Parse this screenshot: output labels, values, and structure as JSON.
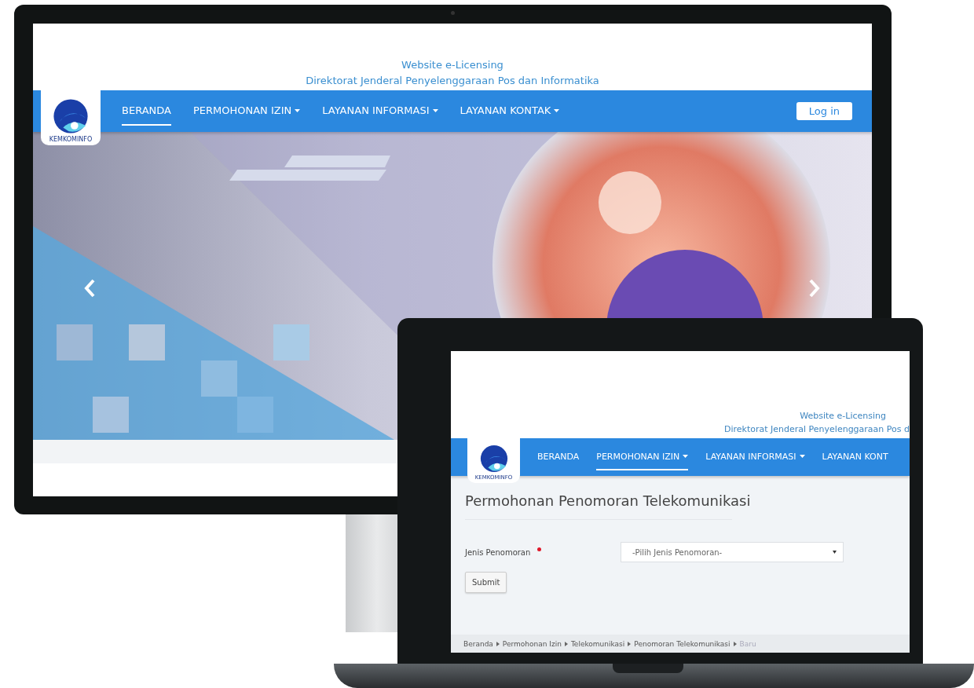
{
  "monitor": {
    "header": {
      "title": "Website e-Licensing",
      "subtitle": "Direktorat Jenderal Penyelenggaraan Pos dan Informatika"
    },
    "logo_text": "KEMKOMINFO",
    "nav": [
      {
        "label": "BERANDA",
        "selected": true,
        "has_menu": false
      },
      {
        "label": "PERMOHONAN IZIN",
        "selected": false,
        "has_menu": true
      },
      {
        "label": "LAYANAN INFORMASI",
        "selected": false,
        "has_menu": true
      },
      {
        "label": "LAYANAN KONTAK",
        "selected": false,
        "has_menu": true
      }
    ],
    "login_button": "Log in"
  },
  "laptop": {
    "header": {
      "title": "Website e-Licensing",
      "subtitle": "Direktorat Jenderal Penyelenggaraan Pos d"
    },
    "logo_text": "KEMKOMINFO",
    "nav": [
      {
        "label": "BERANDA",
        "selected": false,
        "has_menu": false
      },
      {
        "label": "PERMOHONAN IZIN",
        "selected": true,
        "has_menu": true
      },
      {
        "label": "LAYANAN INFORMASI",
        "selected": false,
        "has_menu": true
      },
      {
        "label": "LAYANAN KONT",
        "selected": false,
        "has_menu": false
      }
    ],
    "page_title": "Permohonan Penomoran Telekomunikasi",
    "form": {
      "label": "Jenis Penomoran",
      "required": true,
      "select": {
        "value": "-Pilih Jenis Penomoran-"
      }
    },
    "submit_button": "Submit",
    "breadcrumb": [
      {
        "label": "Beranda",
        "current": false
      },
      {
        "label": "Permohonan Izin",
        "current": false
      },
      {
        "label": "Telekomunikasi",
        "current": false
      },
      {
        "label": "Penomoran Telekomunikasi",
        "current": false
      },
      {
        "label": "Baru",
        "current": true
      }
    ]
  }
}
